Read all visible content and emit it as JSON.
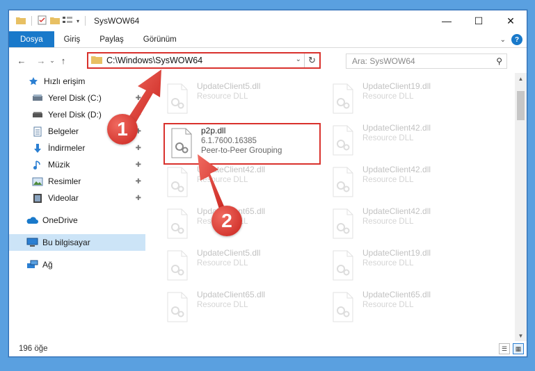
{
  "window": {
    "title": "SysWOW64"
  },
  "window_controls": {
    "minimize": "—",
    "maximize": "☐",
    "close": "✕"
  },
  "ribbon": {
    "tabs": [
      "Dosya",
      "Giriş",
      "Paylaş",
      "Görünüm"
    ]
  },
  "address": {
    "path": "C:\\Windows\\SysWOW64"
  },
  "search": {
    "placeholder": "Ara: SysWOW64"
  },
  "sidebar": {
    "items": [
      {
        "label": "Hızlı erişim",
        "icon": "star-icon",
        "pinned": false
      },
      {
        "label": "Yerel Disk (C:)",
        "icon": "drive-icon",
        "pinned": true
      },
      {
        "label": "Yerel Disk (D:)",
        "icon": "drive-icon",
        "pinned": true
      },
      {
        "label": "Belgeler",
        "icon": "documents-icon",
        "pinned": true
      },
      {
        "label": "İndirmeler",
        "icon": "download-icon",
        "pinned": true
      },
      {
        "label": "Müzik",
        "icon": "music-icon",
        "pinned": true
      },
      {
        "label": "Resimler",
        "icon": "pictures-icon",
        "pinned": true
      },
      {
        "label": "Videolar",
        "icon": "video-icon",
        "pinned": true
      },
      {
        "label": "OneDrive",
        "icon": "cloud-icon",
        "pinned": false
      },
      {
        "label": "Bu bilgisayar",
        "icon": "computer-icon",
        "pinned": false
      },
      {
        "label": "Ağ",
        "icon": "network-icon",
        "pinned": false
      }
    ]
  },
  "files": {
    "highlighted": {
      "name": "p2p.dll",
      "version": "6.1.7600.16385",
      "desc": "Peer-to-Peer Grouping"
    },
    "left_column": [
      {
        "name": "UpdateClient5.dll",
        "desc": "Resource DLL"
      },
      {
        "name": "UpdateClient42.dll",
        "desc": "Resource DLL"
      },
      {
        "name": "UpdateClient65.dll",
        "desc": "Resource DLL"
      },
      {
        "name": "UpdateClient5.dll",
        "desc": "Resource DLL"
      },
      {
        "name": "UpdateClient65.dll",
        "desc": "Resource DLL"
      }
    ],
    "right_column": [
      {
        "name": "UpdateClient19.dll",
        "desc": "Resource DLL"
      },
      {
        "name": "UpdateClient42.dll",
        "desc": "Resource DLL"
      },
      {
        "name": "UpdateClient42.dll",
        "desc": "Resource DLL"
      },
      {
        "name": "UpdateClient42.dll",
        "desc": "Resource DLL"
      },
      {
        "name": "UpdateClient19.dll",
        "desc": "Resource DLL"
      },
      {
        "name": "UpdateClient65.dll",
        "desc": "Resource DLL"
      }
    ]
  },
  "status": {
    "count": "196 öğe"
  },
  "callouts": {
    "one": "1",
    "two": "2"
  },
  "colors": {
    "accent": "#1979ca",
    "highlight": "#d9312c",
    "selected": "#cce4f7"
  }
}
